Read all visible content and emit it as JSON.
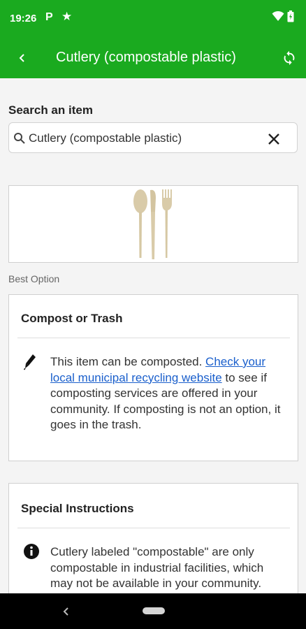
{
  "status_bar": {
    "time": "19:26",
    "notification_p": "P",
    "notification_star": "★"
  },
  "app_bar": {
    "title": "Cutlery (compostable plastic)",
    "back_icon": "chevron-left-icon",
    "refresh_icon": "refresh-icon"
  },
  "search": {
    "label": "Search an item",
    "value": "Cutlery (compostable plastic)",
    "search_icon": "search-icon",
    "clear_icon": "close-icon"
  },
  "result": {
    "image_alt": "cutlery-icon",
    "best_option_label": "Best Option"
  },
  "cards": [
    {
      "title": "Compost or Trash",
      "icon": "pen-icon",
      "text_before": "This item can be composted. ",
      "link": "Check your local municipal recycling website",
      "text_after": " to see if composting services are offered in your community. If composting is not an option, it goes in the trash."
    },
    {
      "title": "Special Instructions",
      "icon": "info-icon",
      "text": "Cutlery labeled \"compostable\" are only compostable in industrial facilities, which may not be available in your community. Please compost or trash it."
    }
  ],
  "colors": {
    "brand_green": "#1aaa1f",
    "link_blue": "#1a5fcc"
  }
}
